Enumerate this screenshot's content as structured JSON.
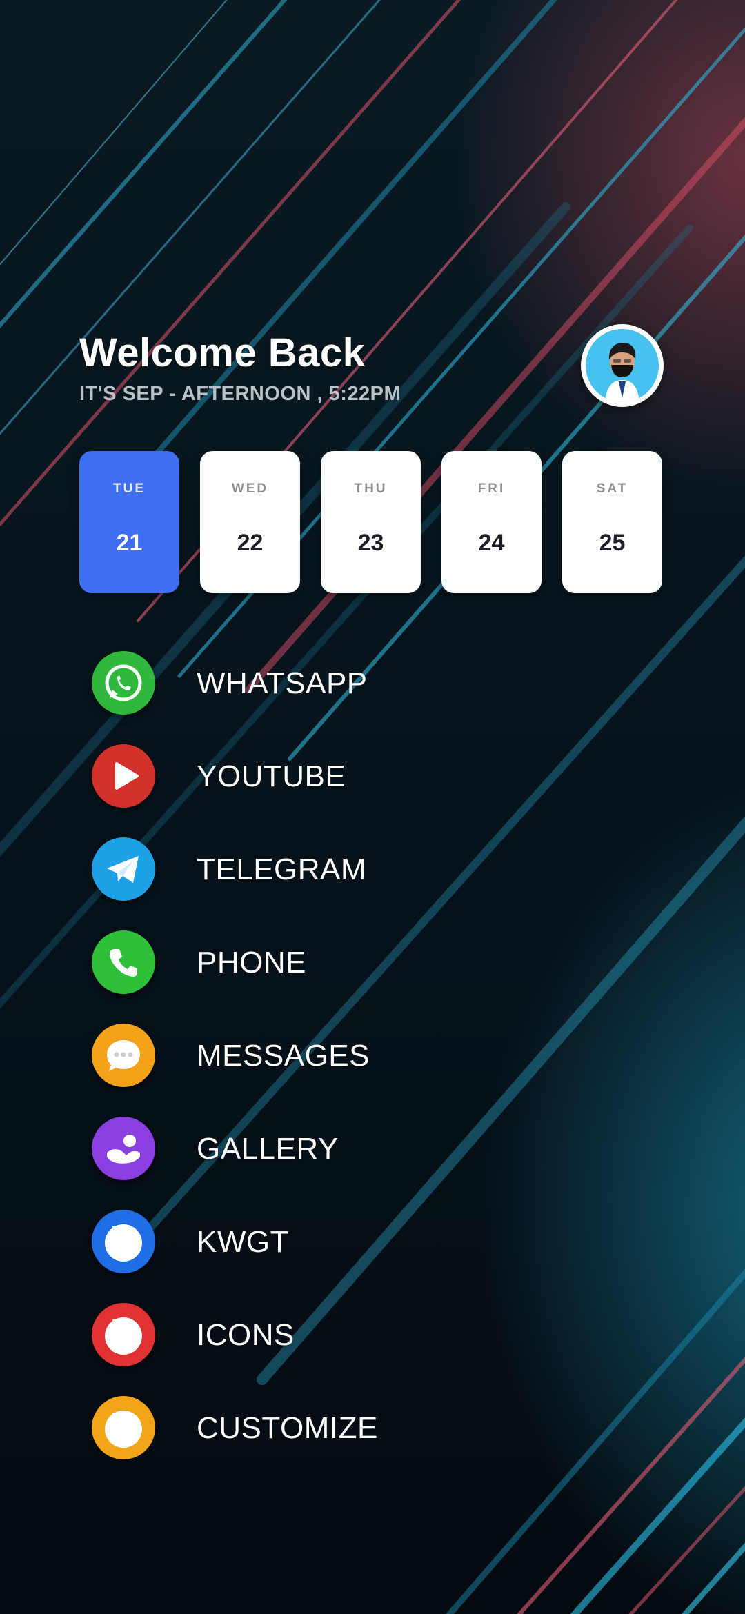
{
  "header": {
    "title": "Welcome Back",
    "subtitle": "IT'S SEP - AFTERNOON , 5:22PM"
  },
  "days": [
    {
      "name": "TUE",
      "num": "21",
      "active": true
    },
    {
      "name": "WED",
      "num": "22",
      "active": false
    },
    {
      "name": "THU",
      "num": "23",
      "active": false
    },
    {
      "name": "FRI",
      "num": "24",
      "active": false
    },
    {
      "name": "SAT",
      "num": "25",
      "active": false
    }
  ],
  "apps": [
    {
      "label": "WHATSAPP",
      "icon": "whatsapp-icon",
      "color": "#2fb83c"
    },
    {
      "label": "YOUTUBE",
      "icon": "youtube-play-icon",
      "color": "#d3322b"
    },
    {
      "label": "TELEGRAM",
      "icon": "telegram-plane-icon",
      "color": "#1ea0e6"
    },
    {
      "label": "PHONE",
      "icon": "phone-icon",
      "color": "#2fbf3a"
    },
    {
      "label": "MESSAGES",
      "icon": "chat-bubble-icon",
      "color": "#f3a21a"
    },
    {
      "label": "GALLERY",
      "icon": "gallery-icon",
      "color": "#8a3fe0"
    },
    {
      "label": "KWGT",
      "icon": "folder-icon",
      "color": "#1f6ee8"
    },
    {
      "label": "ICONS",
      "icon": "folder-icon",
      "color": "#e03232"
    },
    {
      "label": "CUSTOMIZE",
      "icon": "folder-icon",
      "color": "#f2a516"
    }
  ],
  "colors": {
    "accent": "#3f6ff0",
    "avatar_bg": "#47c2f0"
  }
}
